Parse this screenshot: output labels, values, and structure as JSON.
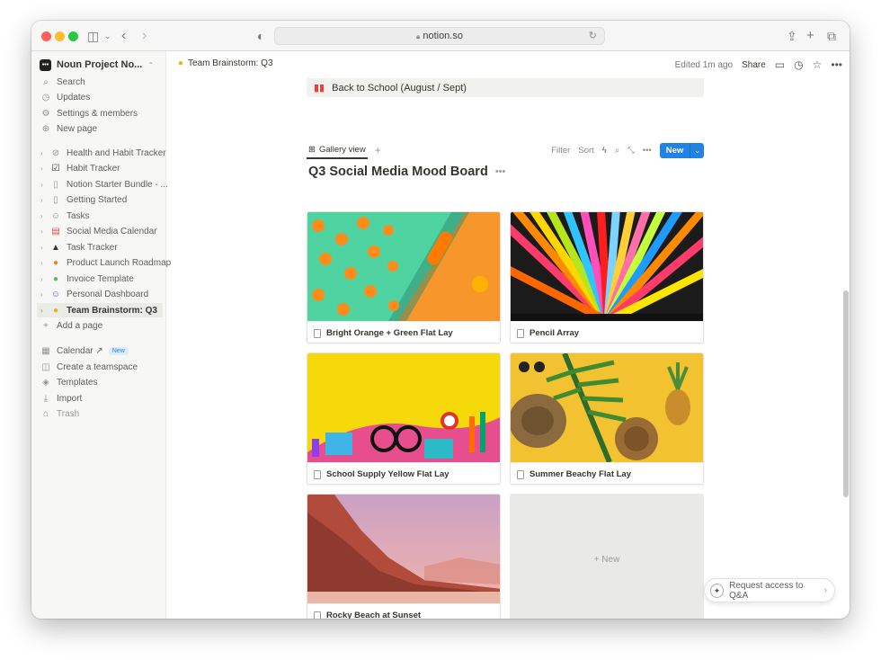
{
  "browser": {
    "url": "notion.so"
  },
  "sidebar": {
    "workspace": "Noun Project No...",
    "top_items": [
      {
        "label": "Search",
        "icon": "search-icon"
      },
      {
        "label": "Updates",
        "icon": "clock-icon"
      },
      {
        "label": "Settings & members",
        "icon": "gear-icon"
      },
      {
        "label": "New page",
        "icon": "plus-circle-icon"
      }
    ],
    "pages": [
      {
        "label": "Health and Habit Tracker",
        "icon": "check-circle-icon"
      },
      {
        "label": "Habit Tracker",
        "icon": "checkbox-icon"
      },
      {
        "label": "Notion Starter Bundle - ...",
        "icon": "page-icon"
      },
      {
        "label": "Getting Started",
        "icon": "page-icon"
      },
      {
        "label": "Tasks",
        "icon": "face-icon"
      },
      {
        "label": "Social Media Calendar",
        "icon": "calendar-icon"
      },
      {
        "label": "Task Tracker",
        "icon": "mountain-icon"
      },
      {
        "label": "Product Launch Roadmap",
        "icon": "emoji-icon"
      },
      {
        "label": "Invoice Template",
        "icon": "emoji-icon"
      },
      {
        "label": "Personal Dashboard",
        "icon": "smile-icon"
      },
      {
        "label": "Team Brainstorm: Q3",
        "icon": "emoji-icon"
      }
    ],
    "add_page": "Add a page",
    "bottom_items": [
      {
        "label": "Calendar ↗",
        "icon": "calendar-icon",
        "badge": "New"
      },
      {
        "label": "Create a teamspace",
        "icon": "teamspace-icon"
      },
      {
        "label": "Templates",
        "icon": "templates-icon"
      },
      {
        "label": "Import",
        "icon": "import-icon"
      },
      {
        "label": "Trash",
        "icon": "trash-icon"
      }
    ]
  },
  "topbar": {
    "breadcrumb": "Team Brainstorm: Q3",
    "edited": "Edited 1m ago",
    "share": "Share"
  },
  "callout": {
    "text": "Back to School (August / Sept)"
  },
  "view": {
    "tab": "Gallery view",
    "filter": "Filter",
    "sort": "Sort",
    "new": "New"
  },
  "database": {
    "title": "Q3 Social Media Mood Board",
    "cards": [
      {
        "title": "Bright Orange + Green Flat Lay"
      },
      {
        "title": "Pencil Array"
      },
      {
        "title": "School Supply Yellow Flat Lay"
      },
      {
        "title": "Summer Beachy Flat Lay"
      },
      {
        "title": "Rocky Beach at Sunset"
      }
    ],
    "new_card": "+ New"
  },
  "qa": {
    "label": "Request access to Q&A"
  },
  "colors": {
    "accent": "#2383e2",
    "sidebar_bg": "#f7f7f5"
  }
}
